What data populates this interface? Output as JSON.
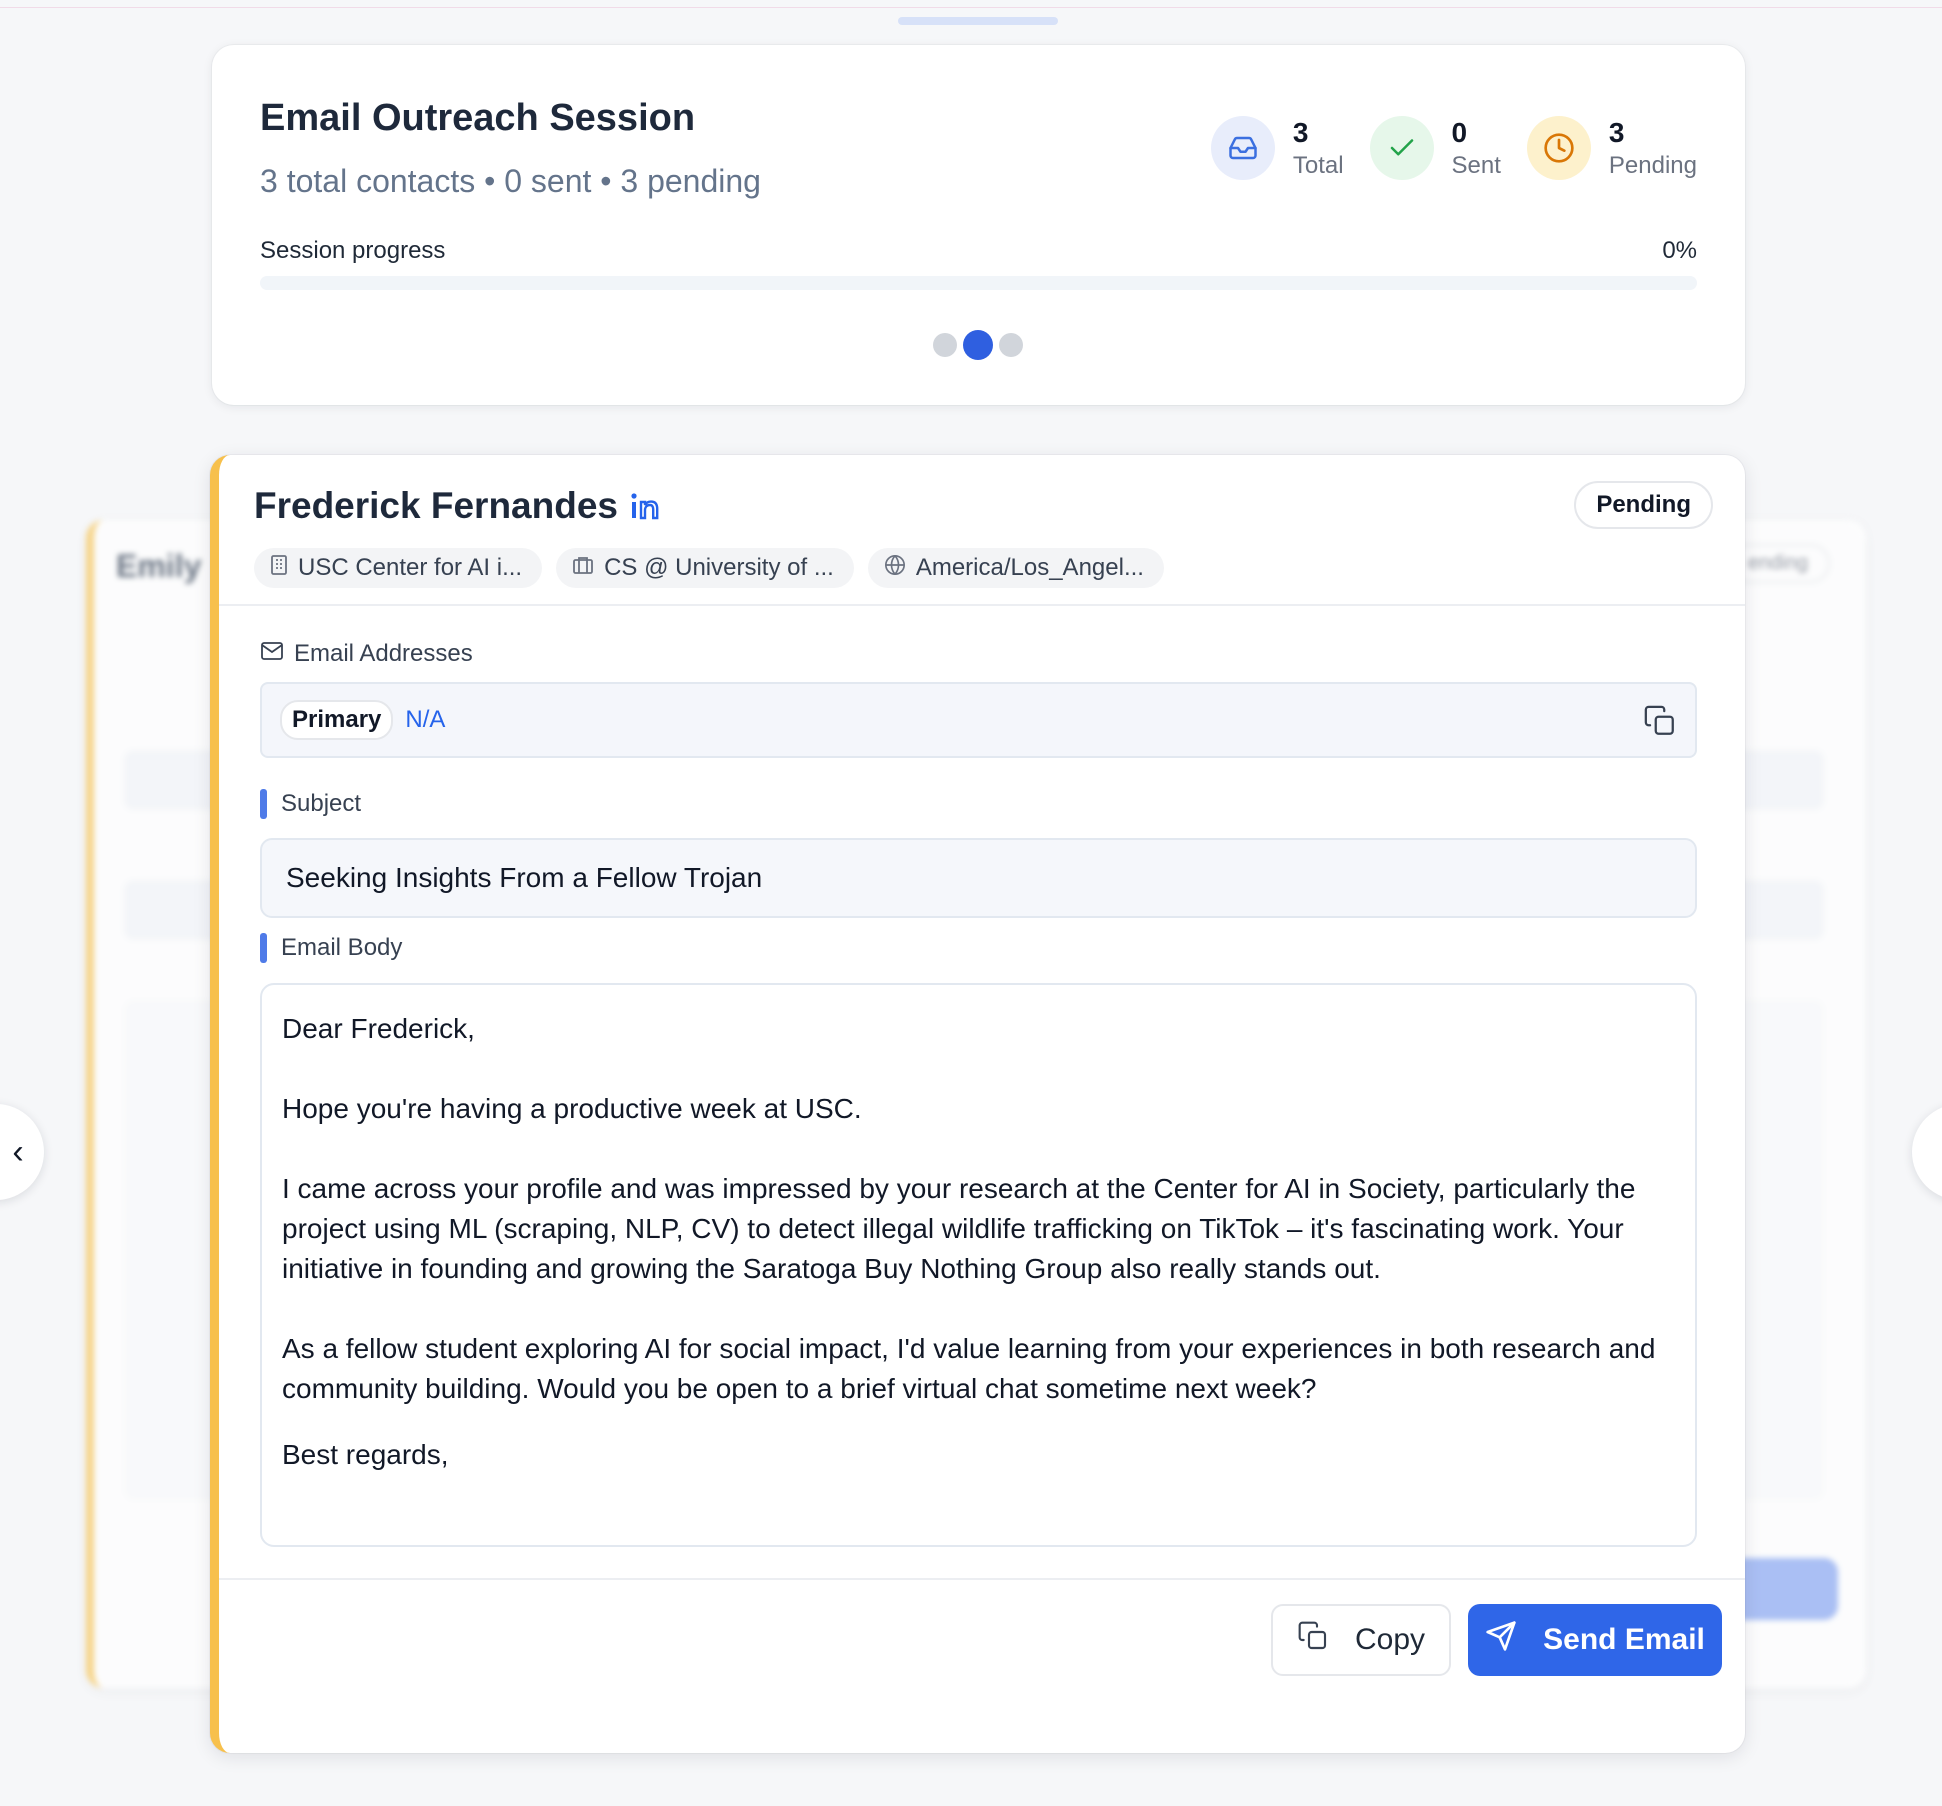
{
  "session": {
    "title": "Email Outreach Session",
    "subtitle": "3 total contacts • 0 sent • 3 pending",
    "stats": {
      "total": {
        "value": "3",
        "label": "Total"
      },
      "sent": {
        "value": "0",
        "label": "Sent"
      },
      "pending": {
        "value": "3",
        "label": "Pending"
      }
    },
    "progress_label": "Session progress",
    "progress_pct": "0%",
    "progress_value": 0,
    "carousel": {
      "count": 3,
      "active_index": 1
    }
  },
  "contact": {
    "name": "Frederick Fernandes",
    "status": "Pending",
    "chips": {
      "organization": "USC Center for AI i...",
      "role": "CS @ University of ...",
      "timezone": "America/Los_Angel..."
    },
    "email_section_label": "Email Addresses",
    "email": {
      "tag": "Primary",
      "value": "N/A"
    },
    "subject_label": "Subject",
    "subject": "Seeking Insights From a Fellow Trojan",
    "body_label": "Email Body",
    "body": {
      "greeting": "Dear Frederick,",
      "p1": "Hope you're having a productive week at USC.",
      "p2": "I came across your profile and was impressed by your research at the Center for AI in Society, particularly the project using ML (scraping, NLP, CV) to detect illegal wildlife trafficking on TikTok – it's fascinating work. Your initiative in founding and growing the Saratoga Buy Nothing Group also really stands out.",
      "p3": "As a fellow student exploring AI for social impact, I'd value learning from your experiences in both research and community building. Would you be open to a brief virtual chat sometime next week?",
      "closing": "Best regards,"
    },
    "actions": {
      "copy": "Copy",
      "send": "Send Email"
    }
  },
  "background_card": {
    "name_fragment": "Emily",
    "status_fragment": "ending"
  },
  "colors": {
    "accent": "#2f66e8",
    "pending_border": "#f7c04c"
  }
}
